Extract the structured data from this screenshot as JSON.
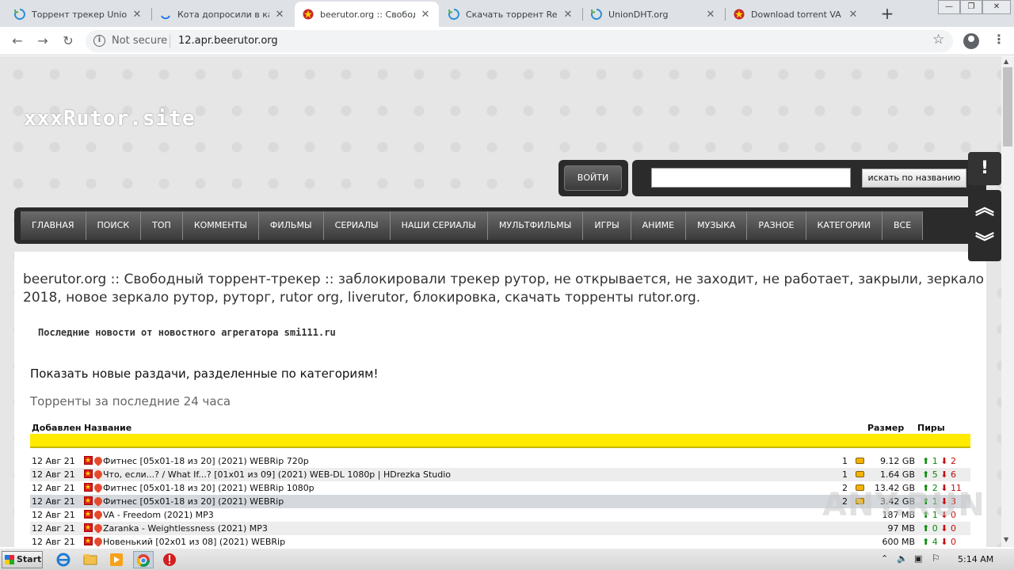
{
  "browser": {
    "tabs": [
      {
        "title": "Торрент трекер UnionP",
        "favicon": "refresh-icon",
        "active": false
      },
      {
        "title": "Кота допросили в каче",
        "favicon": "loading-icon",
        "active": false
      },
      {
        "title": "beerutor.org :: Свобод",
        "favicon": "ussr-star-icon",
        "active": true
      },
      {
        "title": "Скачать торрент Resid",
        "favicon": "refresh-icon",
        "active": false
      },
      {
        "title": "UnionDHT.org",
        "favicon": "refresh-icon",
        "active": false
      },
      {
        "title": "Download torrent VA - F",
        "favicon": "ussr-star-icon",
        "active": false
      }
    ],
    "close_glyph": "✕",
    "new_tab_glyph": "+",
    "security_label": "Not secure",
    "url": "12.apr.beerutor.org"
  },
  "site": {
    "logo": "xxxRutor.site",
    "login_label": "ВОЙТИ",
    "search_button": "искать по названию",
    "search_value": "",
    "menu": [
      "ГЛАВНАЯ",
      "ПОИСК",
      "ТОП",
      "КОММЕНТЫ",
      "ФИЛЬМЫ",
      "СЕРИАЛЫ",
      "НАШИ СЕРИАЛЫ",
      "МУЛЬТФИЛЬМЫ",
      "ИГРЫ",
      "АНИМЕ",
      "МУЗЫКА",
      "РАЗНОЕ",
      "КАТЕГОРИИ",
      "ВСЕ"
    ],
    "side_alert": "!",
    "side_up": "︽",
    "side_down": "︾"
  },
  "content": {
    "headline_line1": "beerutor.org :: Свободный торрент-трекер :: заблокировали трекер рутор, не открывается, не заходит, не работает, закрыли, зеркало",
    "headline_line2": "2018, новое зеркало рутор, руторг, rutor org, liverutor, блокировка, скачать торренты rutor.org.",
    "news": "Последние новости от новостного агрегатора smi111.ru",
    "show_new": "Показать новые раздачи, разделенные по категориям!",
    "last24": "Торренты за последние 24 часа",
    "headers": {
      "added": "Добавлен",
      "name": "Название",
      "size": "Размер",
      "peers": "Пиры"
    },
    "rows": [
      {
        "date": "12 Авг 21",
        "name": "Фитнес [05x01-18 из 20] (2021) WEBRip 720p",
        "comments": "1",
        "size": "9.12 GB",
        "seeds": "1",
        "leech": "2"
      },
      {
        "date": "12 Авг 21",
        "name": "Что, если...? / What If...? [01x01 из 09] (2021) WEB-DL 1080p | HDrezka Studio",
        "comments": "1",
        "size": "1.64 GB",
        "seeds": "5",
        "leech": "6"
      },
      {
        "date": "12 Авг 21",
        "name": "Фитнес [05x01-18 из 20] (2021) WEBRip 1080p",
        "comments": "2",
        "size": "13.42 GB",
        "seeds": "2",
        "leech": "11"
      },
      {
        "date": "12 Авг 21",
        "name": "Фитнес [05x01-18 из 20] (2021) WEBRip",
        "comments": "2",
        "size": "3.42 GB",
        "seeds": "1",
        "leech": "3"
      },
      {
        "date": "12 Авг 21",
        "name": "VA - Freedom (2021) MP3",
        "comments": "",
        "size": "187 MB",
        "seeds": "1",
        "leech": "0"
      },
      {
        "date": "12 Авг 21",
        "name": "Zaranka - Weightlessness (2021) MP3",
        "comments": "",
        "size": "97 MB",
        "seeds": "0",
        "leech": "0"
      },
      {
        "date": "12 Авг 21",
        "name": "Новенький [02x01 из 08] (2021) WEBRip",
        "comments": "",
        "size": "600 MB",
        "seeds": "4",
        "leech": "0"
      }
    ],
    "seed_glyph": "⬆",
    "leech_glyph": "⬇"
  },
  "watermark": "ANY.RUN",
  "taskbar": {
    "start_label": "Start",
    "clock": "5:14 AM"
  },
  "colors": {
    "menu_bg": "#2b2b2b",
    "header_bar": "#ffea00",
    "seed": "#0a8a0a",
    "leech": "#c01010"
  }
}
